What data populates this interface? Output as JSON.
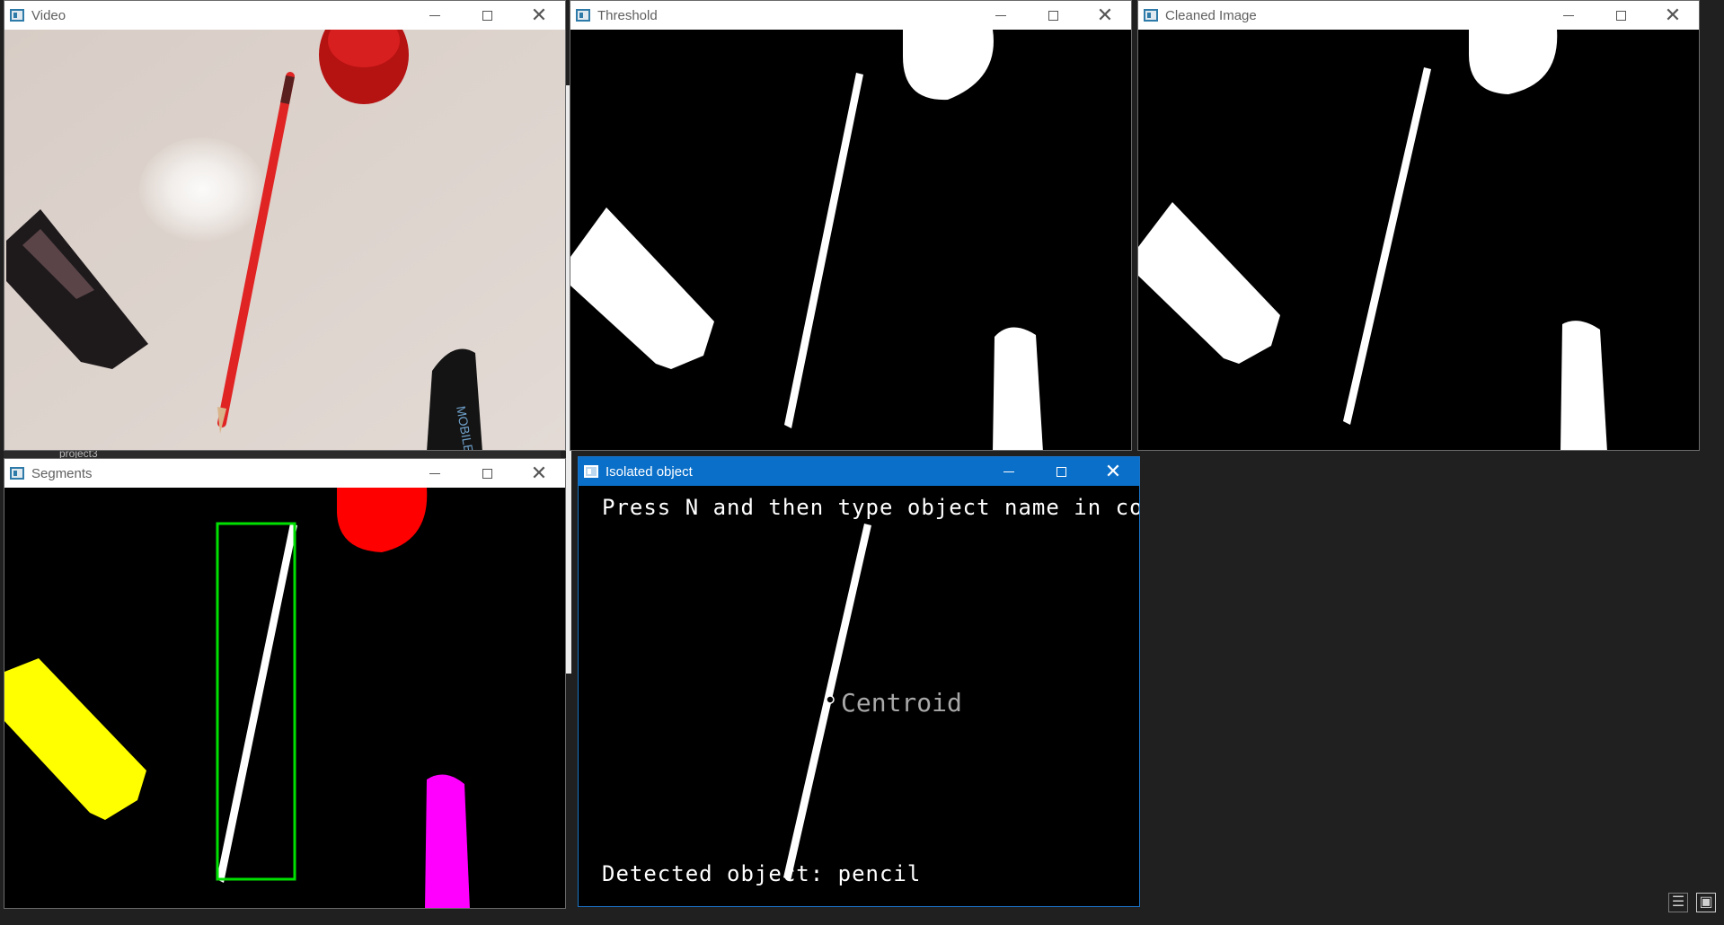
{
  "windows": {
    "video": {
      "title": "Video"
    },
    "threshold": {
      "title": "Threshold"
    },
    "cleaned": {
      "title": "Cleaned Image"
    },
    "segments": {
      "title": "Segments"
    },
    "isolated": {
      "title": "Isolated object",
      "instruction": "Press N and then type object name in console",
      "centroid_label": "Centroid",
      "detected": "Detected object: pencil"
    }
  },
  "background": {
    "folder_label": "project3"
  },
  "colors": {
    "active_titlebar": "#0a6fc9",
    "segment_red": "#ff0000",
    "segment_yellow": "#ffff00",
    "segment_magenta": "#ff00ff",
    "bbox_green": "#00e000"
  },
  "icons": [
    "window-app-icon",
    "minimize-icon",
    "maximize-icon",
    "close-icon",
    "list-view-icon",
    "tile-view-icon"
  ]
}
